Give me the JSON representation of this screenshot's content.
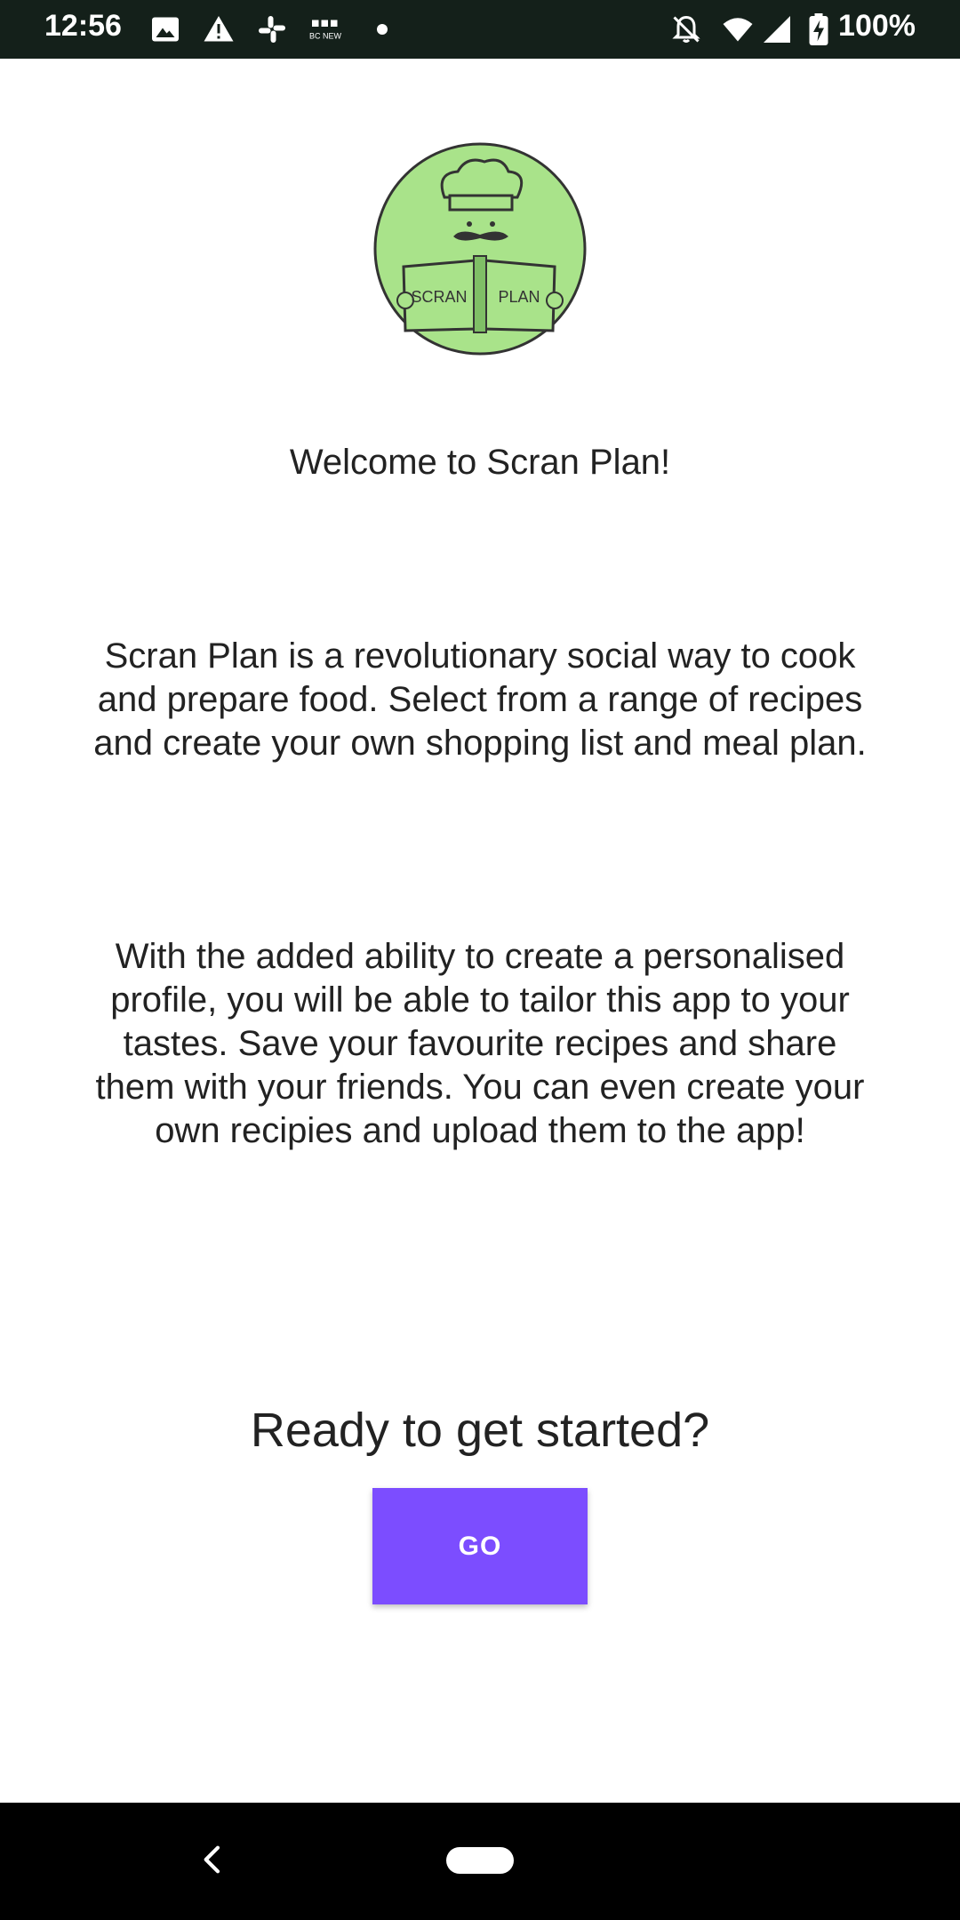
{
  "status_bar": {
    "time": "12:56",
    "battery": "100%",
    "icons": [
      "image-icon",
      "warning-icon",
      "slack-icon",
      "bbc-news-icon",
      "dot-icon",
      "bell-off-icon",
      "wifi-icon",
      "signal-icon",
      "battery-charging-icon"
    ],
    "news_badge": "BBC NEWS"
  },
  "logo": {
    "left_page_text": "SCRAN",
    "right_page_text": "PLAN",
    "fill_color": "#a9e38a"
  },
  "main": {
    "welcome": "Welcome to Scran Plan!",
    "description": "Scran Plan is a revolutionary social way to cook and prepare food. Select from a range of recipes and create your own shopping list and meal plan.",
    "features": "With the added ability to create a personalised profile, you will be able to tailor this app to your tastes. Save your favourite recipes and share them with your friends. You can even create your own recipies and upload them to the app!",
    "ready_prompt": "Ready to get started?",
    "go_label": "GO",
    "accent_color": "#7c4dff"
  },
  "nav_bar": {
    "icons": [
      "back-icon",
      "home-pill-icon"
    ]
  }
}
